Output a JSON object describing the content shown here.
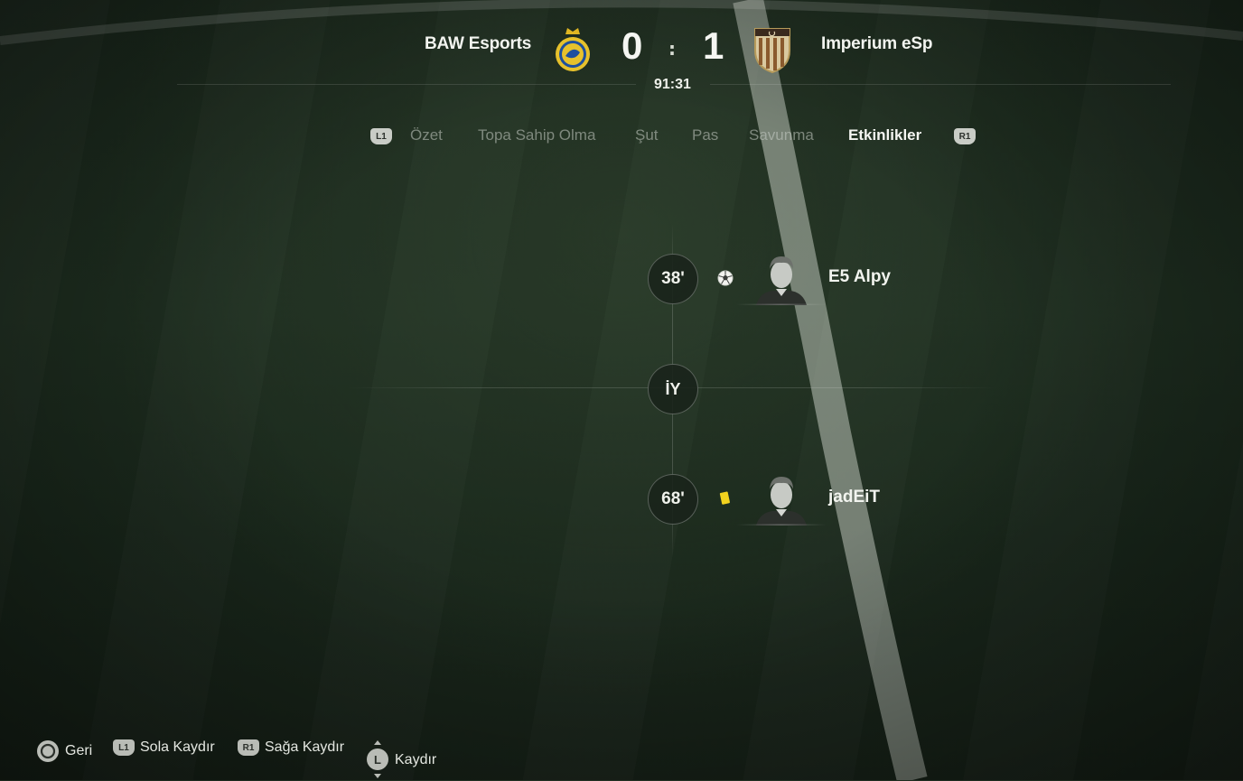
{
  "match": {
    "home_team": "BAW Esports",
    "away_team": "Imperium eSp",
    "home_score": "0",
    "away_score": "1",
    "score_separator": ":",
    "clock": "91:31"
  },
  "tabs": {
    "left_bumper": "L1",
    "right_bumper": "R1",
    "items": [
      {
        "label": "Özet",
        "active": false
      },
      {
        "label": "Topa Sahip Olma",
        "active": false
      },
      {
        "label": "Şut",
        "active": false
      },
      {
        "label": "Pas",
        "active": false
      },
      {
        "label": "Savunma",
        "active": false
      },
      {
        "label": "Etkinlikler",
        "active": true
      }
    ]
  },
  "timeline": {
    "events": [
      {
        "minute": "38'",
        "type": "goal",
        "icon": "ball-icon",
        "player": "E5 Alpy"
      },
      {
        "minute": "68'",
        "type": "yellow-card",
        "icon": "yellow-card-icon",
        "player": "jadEiT"
      }
    ],
    "half_time_marker": "İY"
  },
  "footer": {
    "back": {
      "button": "circle-button-icon",
      "label": "Geri"
    },
    "scroll_left": {
      "button": "L1",
      "label": "Sola Kaydır"
    },
    "scroll_right": {
      "button": "R1",
      "label": "Sağa Kaydır"
    },
    "scroll": {
      "button": "L",
      "label": "Kaydır"
    }
  },
  "colors": {
    "yellow_card": "#f2d21e",
    "active_tab": "#f4f5f1",
    "inactive_tab": "#8e968c"
  }
}
